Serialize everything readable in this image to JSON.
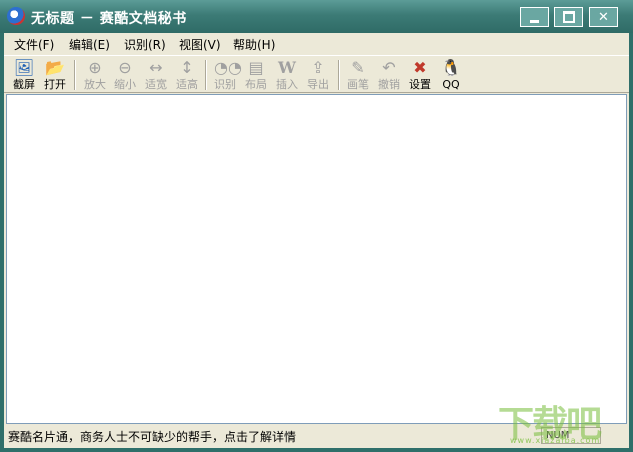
{
  "window": {
    "title": "无标题 － 赛酷文档秘书",
    "icon": "app-logo-icon",
    "controls": [
      "minimize",
      "maximize",
      "close"
    ]
  },
  "menu": [
    {
      "label": "文件(F)"
    },
    {
      "label": "编辑(E)"
    },
    {
      "label": "识别(R)"
    },
    {
      "label": "视图(V)"
    },
    {
      "label": "帮助(H)"
    }
  ],
  "toolbar": [
    {
      "label": "截屏",
      "icon": "screenshot-icon",
      "enabled": true
    },
    {
      "label": "打开",
      "icon": "folder-open-icon",
      "enabled": true
    },
    {
      "label": "放大",
      "icon": "zoom-in-icon",
      "enabled": false
    },
    {
      "label": "缩小",
      "icon": "zoom-out-icon",
      "enabled": false
    },
    {
      "label": "适宽",
      "icon": "fit-width-icon",
      "enabled": false
    },
    {
      "label": "适高",
      "icon": "fit-height-icon",
      "enabled": false
    },
    {
      "label": "识别",
      "icon": "recognize-icon",
      "enabled": false
    },
    {
      "label": "布局",
      "icon": "layout-icon",
      "enabled": false
    },
    {
      "label": "插入",
      "icon": "insert-word-icon",
      "enabled": false
    },
    {
      "label": "导出",
      "icon": "export-icon",
      "enabled": false
    },
    {
      "label": "画笔",
      "icon": "pen-icon",
      "enabled": false
    },
    {
      "label": "撤销",
      "icon": "undo-icon",
      "enabled": false
    },
    {
      "label": "设置",
      "icon": "settings-tools-icon",
      "enabled": true
    },
    {
      "label": "QQ",
      "icon": "qq-penguin-icon",
      "enabled": true
    }
  ],
  "status": {
    "message": "赛酷名片通，商务人士不可缺少的帮手，点击了解详情",
    "indicator": "NUM"
  },
  "watermark": {
    "text": "下载吧",
    "sub": "www.xiazaiba.com"
  },
  "colors": {
    "titlebar": "#3c7b76",
    "chrome": "#ece9d8",
    "disabled_text": "#a0a0a0"
  }
}
